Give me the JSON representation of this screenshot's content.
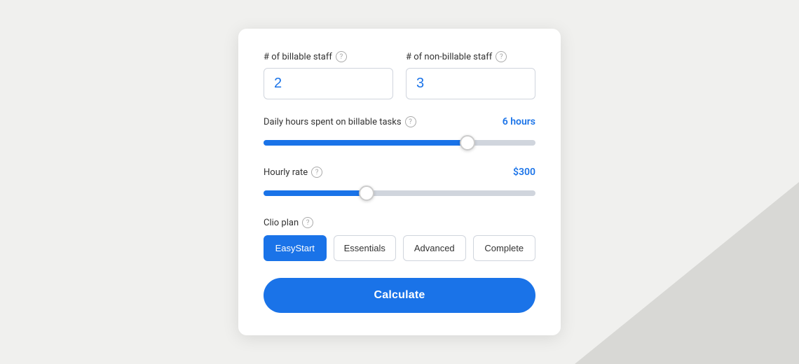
{
  "card": {
    "billable_staff": {
      "label": "# of billable staff",
      "value": "2"
    },
    "non_billable_staff": {
      "label": "# of non-billable staff",
      "value": "3"
    },
    "daily_hours": {
      "label": "Daily hours spent on billable tasks",
      "value_display": "6 hours",
      "value": 6,
      "min": 0,
      "max": 24,
      "fill_percent": 75
    },
    "hourly_rate": {
      "label": "Hourly rate",
      "value_display": "$300",
      "value": 300,
      "min": 0,
      "max": 1000,
      "fill_percent": 38
    },
    "clio_plan": {
      "label": "Clio plan",
      "options": [
        "EasyStart",
        "Essentials",
        "Advanced",
        "Complete"
      ],
      "selected": "EasyStart"
    },
    "calculate_btn": "Calculate"
  },
  "colors": {
    "accent": "#1a73e8",
    "border": "#d0d5dd",
    "text": "#333333"
  }
}
